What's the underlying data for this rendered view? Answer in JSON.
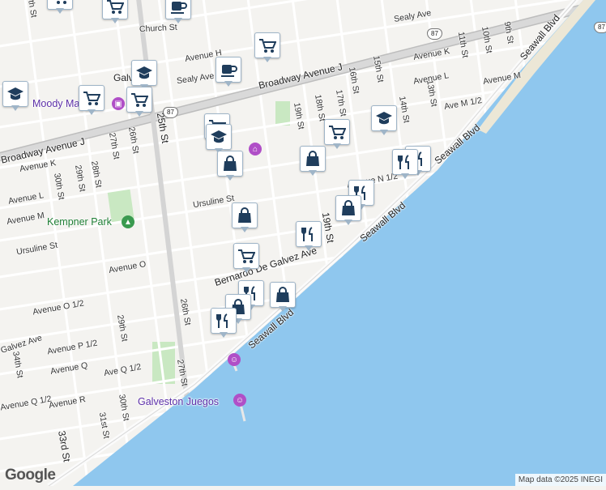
{
  "map": {
    "street_labels": [
      {
        "text": "Church St"
      },
      {
        "text": "Sealy Ave"
      },
      {
        "text": "Sealy Ave"
      },
      {
        "text": "Avenue H"
      },
      {
        "text": "Broadway Avenue J"
      },
      {
        "text": "Broadway Avenue J"
      },
      {
        "text": "Avenue K"
      },
      {
        "text": "Avenue K"
      },
      {
        "text": "Avenue L"
      },
      {
        "text": "Avenue L"
      },
      {
        "text": "Avenue M"
      },
      {
        "text": "Avenue M"
      },
      {
        "text": "Ave M 1/2"
      },
      {
        "text": "Avenue N 1/2"
      },
      {
        "text": "Avenue O"
      },
      {
        "text": "Avenue O 1/2"
      },
      {
        "text": "Avenue P 1/2"
      },
      {
        "text": "Avenue Q"
      },
      {
        "text": "Ave Q 1/2"
      },
      {
        "text": "Avenue Q 1/2"
      },
      {
        "text": "Avenue R"
      },
      {
        "text": "Ursuline St"
      },
      {
        "text": "Ursuline St"
      },
      {
        "text": "Galvez Ave"
      },
      {
        "text": "Bernardo De Galvez Ave"
      },
      {
        "text": "Seawall Blvd"
      },
      {
        "text": "Seawall Blvd"
      },
      {
        "text": "Seawall Blvd"
      },
      {
        "text": "Seawall Blvd"
      },
      {
        "text": "9th St"
      },
      {
        "text": "10th St"
      },
      {
        "text": "11th St"
      },
      {
        "text": "13th St"
      },
      {
        "text": "14th St"
      },
      {
        "text": "15th St"
      },
      {
        "text": "16th St"
      },
      {
        "text": "17th St"
      },
      {
        "text": "18th St"
      },
      {
        "text": "19th St"
      },
      {
        "text": "19th St"
      },
      {
        "text": "25th St"
      },
      {
        "text": "26th St"
      },
      {
        "text": "26th St"
      },
      {
        "text": "27th St"
      },
      {
        "text": "27th St"
      },
      {
        "text": "28th St"
      },
      {
        "text": "29th St"
      },
      {
        "text": "29th St"
      },
      {
        "text": "30th St"
      },
      {
        "text": "30th St"
      },
      {
        "text": "31st St"
      },
      {
        "text": "33rd St"
      },
      {
        "text": "34th St"
      },
      {
        "text": "35th St"
      }
    ],
    "place_labels": [
      {
        "text": "Galveston"
      },
      {
        "text": "Moody Ma"
      },
      {
        "text": "Kempner Park"
      },
      {
        "text": "Galveston Juegos"
      }
    ],
    "highway_shields": [
      "87",
      "87",
      "87"
    ],
    "markers": [
      {
        "icon": "shopping-cart-icon"
      },
      {
        "icon": "coffee-cup-icon"
      },
      {
        "icon": "graduation-cap-icon"
      },
      {
        "icon": "graduation-cap-icon"
      },
      {
        "icon": "shopping-cart-icon"
      },
      {
        "icon": "shopping-cart-icon"
      },
      {
        "icon": "shopping-cart-icon"
      },
      {
        "icon": "graduation-cap-icon"
      },
      {
        "icon": "shopping-bag-icon"
      },
      {
        "icon": "shopping-cart-icon"
      },
      {
        "icon": "graduation-cap-icon"
      },
      {
        "icon": "shopping-bag-icon"
      },
      {
        "icon": "restaurant-icon"
      },
      {
        "icon": "restaurant-icon"
      },
      {
        "icon": "restaurant-icon"
      },
      {
        "icon": "shopping-bag-icon"
      },
      {
        "icon": "shopping-bag-icon"
      },
      {
        "icon": "restaurant-icon"
      },
      {
        "icon": "shopping-cart-icon"
      },
      {
        "icon": "restaurant-icon"
      },
      {
        "icon": "shopping-bag-icon"
      },
      {
        "icon": "shopping-bag-icon"
      },
      {
        "icon": "restaurant-icon"
      },
      {
        "icon": "shopping-cart-icon"
      },
      {
        "icon": "coffee-cup-icon"
      },
      {
        "icon": "shopping-cart-icon"
      }
    ],
    "colors": {
      "water": "#8fc7ee",
      "land": "#f4f3f0",
      "park": "#c9e8c2",
      "major_road": "#c7c7c7",
      "marker_icon": "#1f3d5c"
    }
  },
  "footer": {
    "logo": "Google",
    "attribution": "Map data ©2025 INEGI"
  }
}
